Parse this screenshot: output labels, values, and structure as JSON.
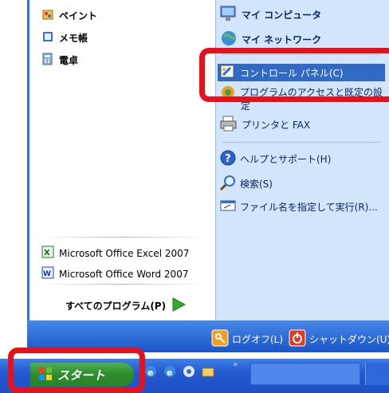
{
  "left_column": {
    "pinned": [
      {
        "label": "ペイント",
        "icon": "paint-icon"
      },
      {
        "label": "メモ帳",
        "icon": "notepad-icon"
      },
      {
        "label": "電卓",
        "icon": "calculator-icon"
      }
    ],
    "recent": [
      {
        "label": "Microsoft Office Excel 2007",
        "icon": "excel-icon"
      },
      {
        "label": "Microsoft Office Word 2007",
        "icon": "word-icon"
      }
    ],
    "all_programs_label": "すべてのプログラム(P)"
  },
  "right_column": {
    "my_computer": "マイ コンピュータ",
    "my_network": "マイ ネットワーク",
    "control_panel": "コントロール パネル(C)",
    "program_access_line1": "プログラムのアクセスと既定の設",
    "program_access_line2": "定",
    "printers": "プリンタと FAX",
    "help": "ヘルプとサポート(H)",
    "search": "検索(S)",
    "run": "ファイル名を指定して実行(R)..."
  },
  "bottom": {
    "logoff": "ログオフ(L)",
    "shutdown": "シャットダウン(U)"
  },
  "taskbar": {
    "start_label": "スタート",
    "chevron": "»"
  },
  "colors": {
    "highlight": "#316ac5",
    "annotation_red": "#e8101a",
    "start_green": "#2d8c2d"
  }
}
